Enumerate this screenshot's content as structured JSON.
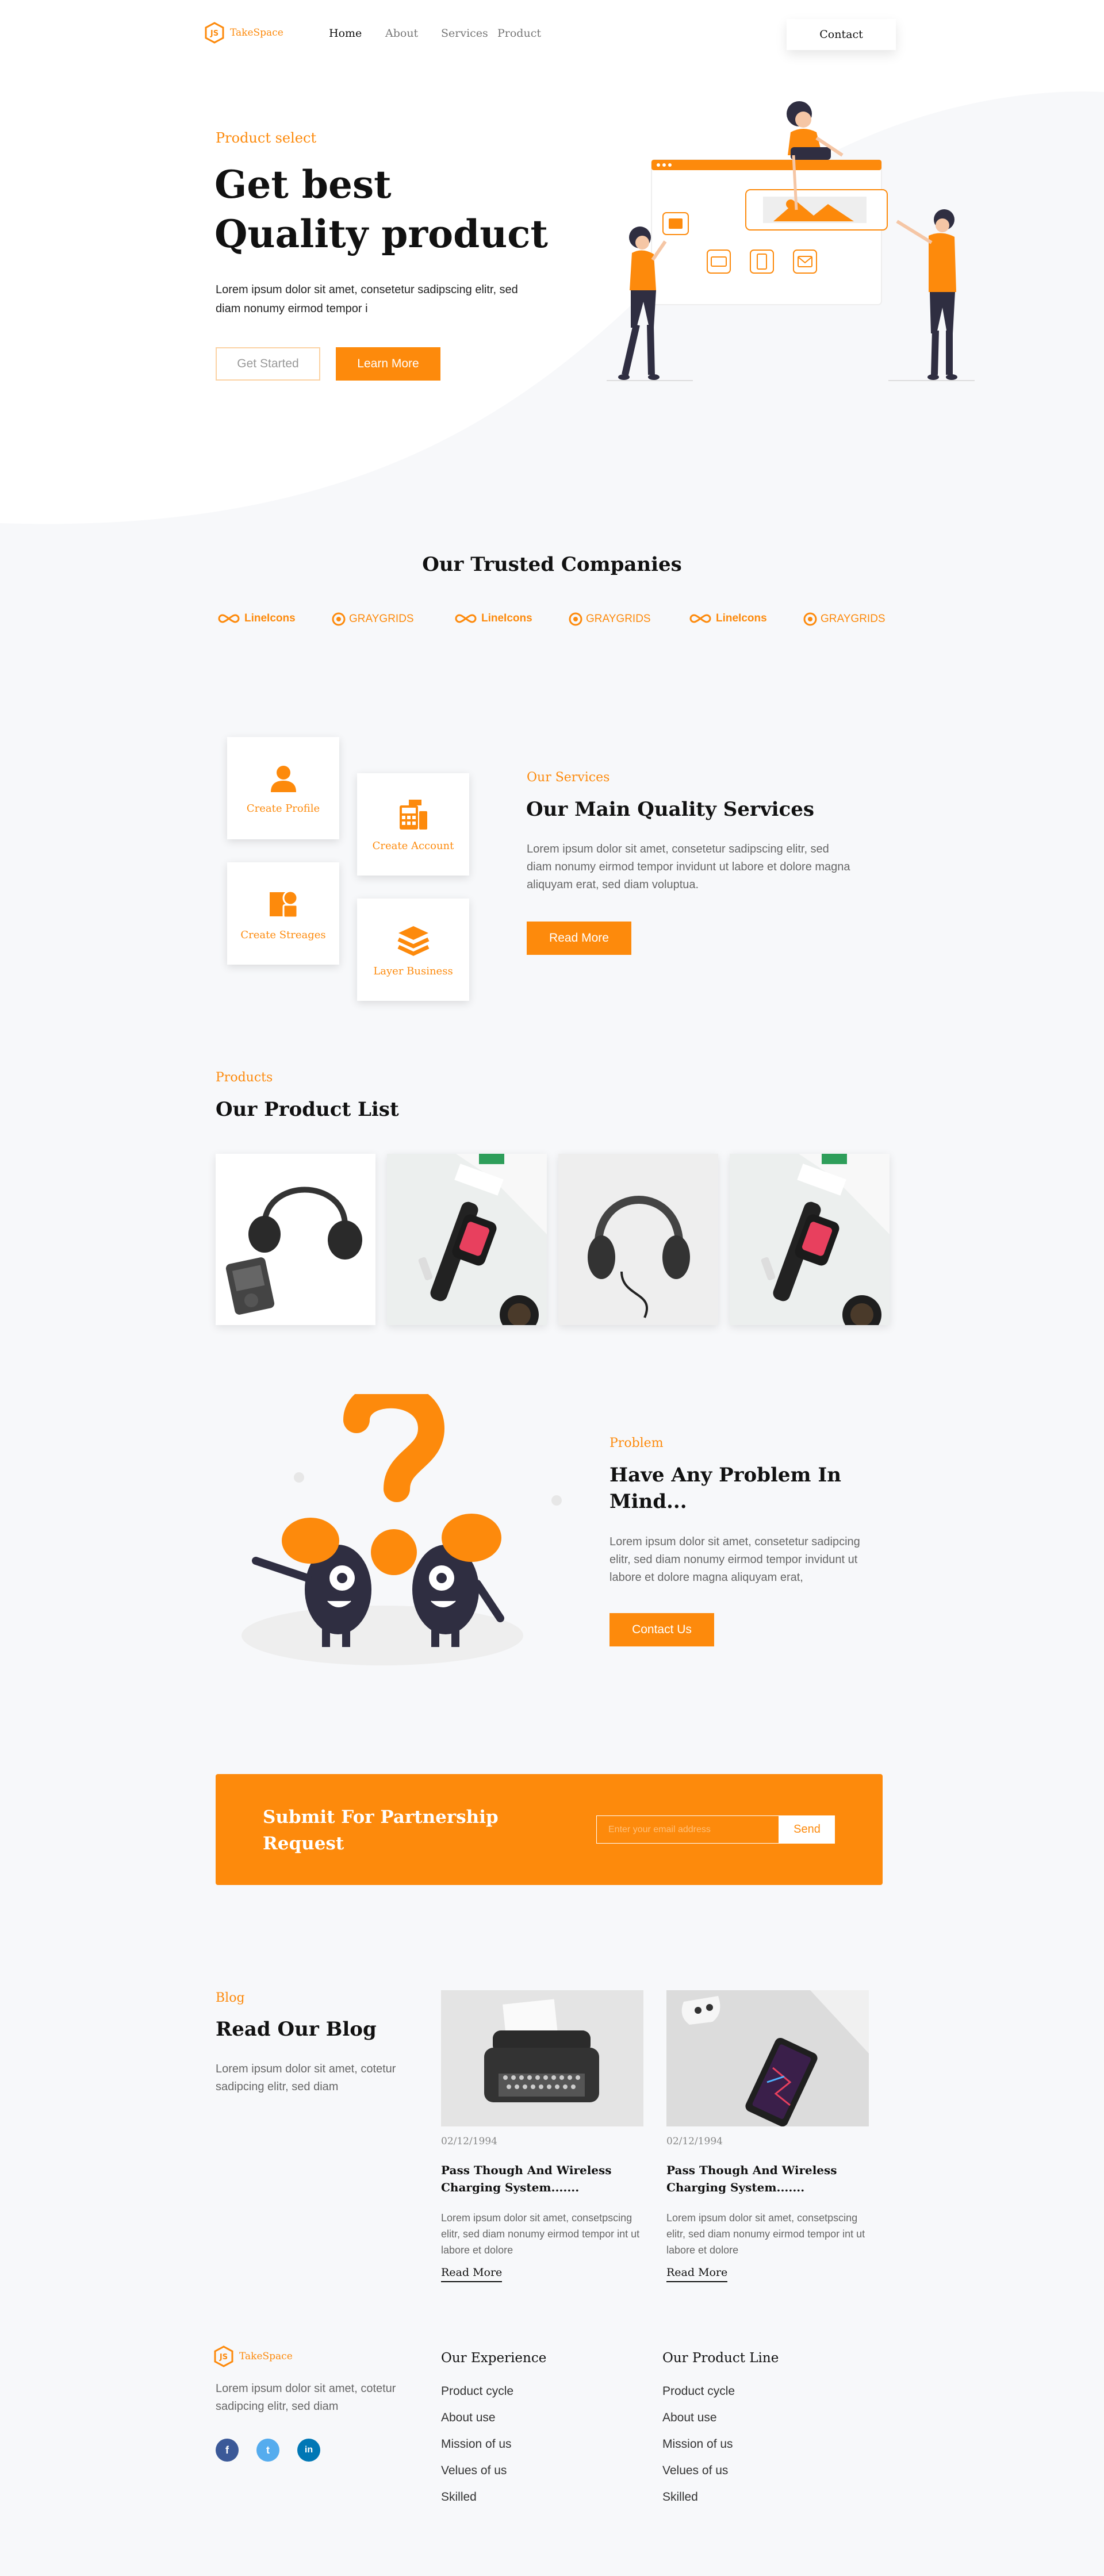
{
  "brand": {
    "name": "TakeSpace",
    "logo_icon": "js-hexagon-icon"
  },
  "nav": {
    "items": [
      "Home",
      "About",
      "Services",
      "Product"
    ],
    "contact_label": "Contact"
  },
  "hero": {
    "eyebrow": "Product select",
    "title_line1": "Get best",
    "title_line2": "Quality product",
    "text": "Lorem ipsum dolor sit amet, consetetur sadipscing elitr, sed diam nonumy eirmod tempor i",
    "get_started": "Get Started",
    "learn_more": "Learn More"
  },
  "trusted": {
    "title": "Our Trusted Companies",
    "logos": [
      "LineIcons",
      "GRAYGRIDS",
      "LineIcons",
      "GRAYGRIDS",
      "LineIcons",
      "GRAYGRIDS"
    ]
  },
  "services": {
    "eyebrow": "Our Services",
    "title": "Our Main Quality Services",
    "text": "Lorem ipsum dolor sit amet, consetetur sadipscing elitr, sed diam nonumy eirmod tempor invidunt ut labore et dolore magna aliquyam erat, sed diam voluptua.",
    "button": "Read More",
    "cards": [
      "Create Profile",
      "Create Account",
      "Create Streages",
      "Layer Business"
    ]
  },
  "products": {
    "eyebrow": "Products",
    "title": "Our Product List"
  },
  "problem": {
    "eyebrow": "Problem",
    "title_line1": "Have Any Problem In",
    "title_line2": "Mind...",
    "text": "Lorem ipsum dolor sit amet, consetetur sadipcing elitr, sed diam nonumy eirmod tempor invidunt ut labore et dolore magna aliquyam erat,",
    "button": "Contact Us"
  },
  "partnership": {
    "title_line1": "Submit For Partnership",
    "title_line2": "Request",
    "placeholder": "Enter your email address",
    "send": "Send"
  },
  "blog": {
    "eyebrow": "Blog",
    "title": "Read Our Blog",
    "text": "Lorem ipsum dolor sit amet, cotetur sadipcing elitr, sed diam",
    "posts": [
      {
        "date": "02/12/1994",
        "title": "Pass Though And Wireless Charging System.......",
        "text": "Lorem ipsum dolor sit amet, consetpscing elitr, sed diam nonumy eirmod tempor int ut labore et dolore",
        "link": "Read More"
      },
      {
        "date": "02/12/1994",
        "title": "Pass Though And Wireless Charging System.......",
        "text": "Lorem ipsum dolor sit amet, consetpscing elitr, sed diam nonumy eirmod tempor int ut labore et dolore",
        "link": "Read More"
      }
    ]
  },
  "footer": {
    "brand_text": "Lorem ipsum dolor sit amet, cotetur sadipcing elitr, sed diam",
    "social": [
      "facebook-icon",
      "twitter-icon",
      "linkedin-icon"
    ],
    "col1_title": "Our Experience",
    "col1_links": [
      "Product cycle",
      "About use",
      "Mission of us",
      "Velues of us",
      "Skilled"
    ],
    "col2_title": "Our Product Line",
    "col2_links": [
      "Product cycle",
      "About use",
      "Mission of us",
      "Velues of us",
      "Skilled"
    ]
  },
  "colors": {
    "accent": "#fd8a0c",
    "dark": "#2f2e41",
    "background": "#f7f8fa"
  }
}
